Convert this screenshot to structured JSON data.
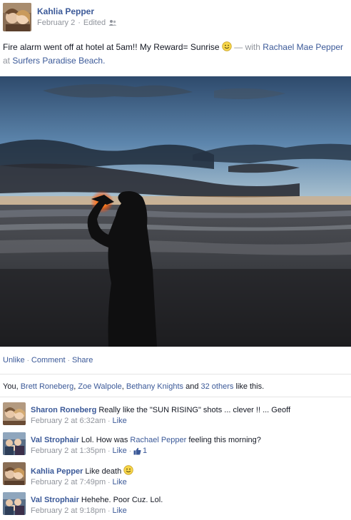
{
  "post": {
    "author": "Kahlia Pepper",
    "date": "February 2",
    "edited": "Edited",
    "status_text": "Fire alarm went off at hotel at 5am!! My Reward= Sunrise",
    "with_prefix": "— with",
    "tagged_person": "Rachael Mae Pepper",
    "at_word": "at",
    "location": "Surfers Paradise Beach."
  },
  "actions": {
    "unlike": "Unlike",
    "comment": "Comment",
    "share": "Share",
    "separator": "·"
  },
  "likes": {
    "you": "You,",
    "names": [
      "Brett Roneberg",
      "Zoe Walpole",
      "Bethany Knights"
    ],
    "and": "and",
    "others": "32 others",
    "suffix": "like this."
  },
  "comments": [
    {
      "author": "Sharon Roneberg",
      "text": "Really like the \"SUN RISING\" shots ... clever !! ... Geoff",
      "time": "February 2 at 6:32am",
      "like": "Like"
    },
    {
      "author": "Val Strophair",
      "text_before": "Lol. How was",
      "mention": "Rachael Pepper",
      "text_after": "feeling this morning?",
      "time": "February 2 at 1:35pm",
      "like": "Like",
      "like_count": "1"
    },
    {
      "author": "Kahlia Pepper",
      "text": "Like death",
      "time": "February 2 at 7:49pm",
      "like": "Like"
    },
    {
      "author": "Val Strophair",
      "text": "Hehehe. Poor Cuz. Lol.",
      "time": "February 2 at 9:18pm",
      "like": "Like"
    }
  ],
  "colors": {
    "link": "#3b5998",
    "muted": "#90949c",
    "text": "#141823"
  }
}
